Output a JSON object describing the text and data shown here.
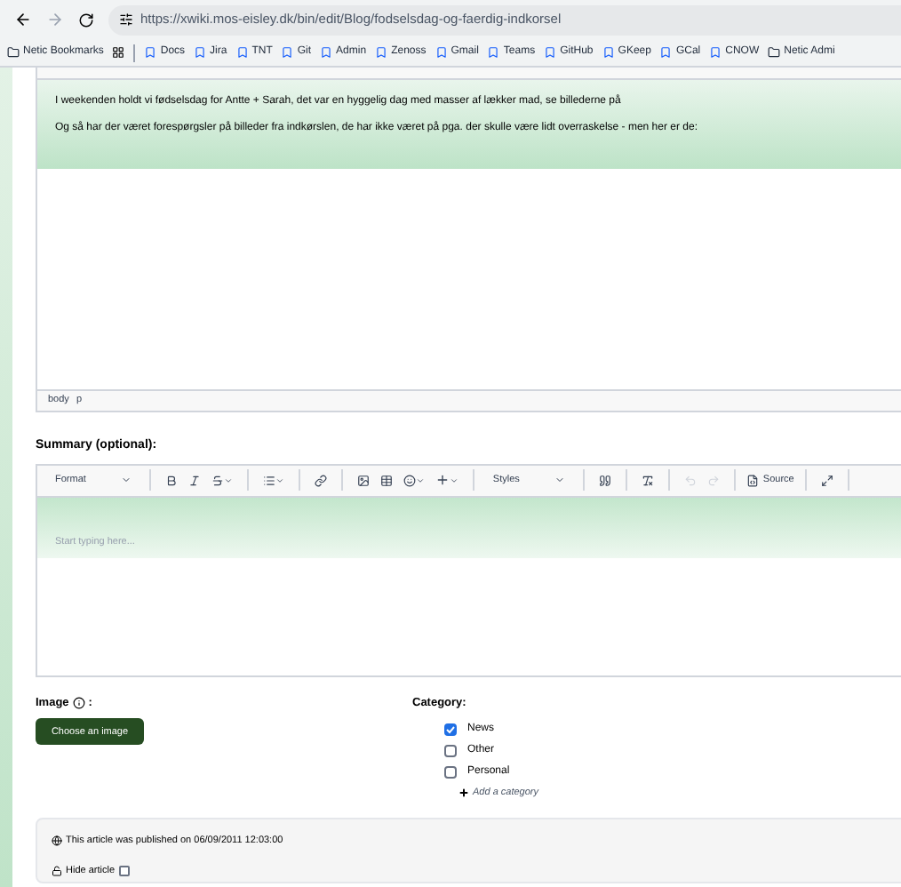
{
  "browser": {
    "url": "https://xwiki.mos-eisley.dk/bin/edit/Blog/fodselsdag-og-faerdig-indkorsel",
    "bookmarks": [
      {
        "label": "Netic Bookmarks",
        "kind": "folder"
      },
      {
        "label": "Docs",
        "kind": "link"
      },
      {
        "label": "Jira",
        "kind": "link"
      },
      {
        "label": "TNT",
        "kind": "link"
      },
      {
        "label": "Git",
        "kind": "link"
      },
      {
        "label": "Admin",
        "kind": "link"
      },
      {
        "label": "Zenoss",
        "kind": "link"
      },
      {
        "label": "Gmail",
        "kind": "link"
      },
      {
        "label": "Teams",
        "kind": "link"
      },
      {
        "label": "GitHub",
        "kind": "link"
      },
      {
        "label": "GKeep",
        "kind": "link"
      },
      {
        "label": "GCal",
        "kind": "link"
      },
      {
        "label": "CNOW",
        "kind": "link"
      },
      {
        "label": "Netic Admi",
        "kind": "folder"
      }
    ]
  },
  "content_editor": {
    "paragraphs": [
      "I weekenden holdt vi fødselsdag for Antte + Sarah, det var en hyggelig dag med masser af lækker mad, se billederne på",
      "Og så har der været forespørgsler på billeder fra indkørslen, de har ikke været på pga. der skulle være lidt overraskelse - men her er de:"
    ],
    "path": [
      "body",
      "p"
    ]
  },
  "summary": {
    "label": "Summary (optional):",
    "format": "Format",
    "styles": "Styles",
    "source": "Source",
    "placeholder": "Start typing here..."
  },
  "image": {
    "label": "Image",
    "colon": ":",
    "button": "Choose an image"
  },
  "category": {
    "label": "Category:",
    "options": [
      {
        "label": "News",
        "checked": true
      },
      {
        "label": "Other",
        "checked": false
      },
      {
        "label": "Personal",
        "checked": false
      }
    ],
    "add": "Add a category"
  },
  "publish": {
    "text": "This article was published on 06/09/2011 12:03:00",
    "hide_label": "Hide article",
    "hidden": false
  }
}
